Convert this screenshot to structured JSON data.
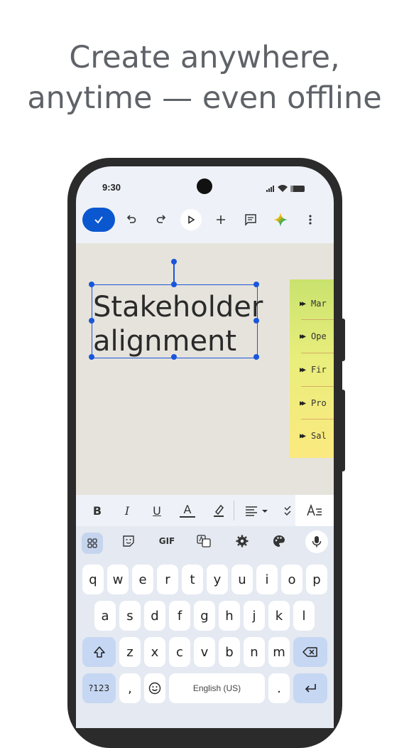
{
  "headline": {
    "line1": "Create anywhere,",
    "line2": "anytime — even offline"
  },
  "status_bar": {
    "time": "9:30"
  },
  "toolbar": {
    "items": [
      "check-icon",
      "undo-icon",
      "redo-icon",
      "present-icon",
      "add-icon",
      "comment-icon",
      "gemini-icon",
      "more-vert-icon"
    ]
  },
  "slide": {
    "title_line1": "Stakeholder",
    "title_line2": "alignment",
    "sticky_items": [
      "Mar",
      "Ope",
      "Fir",
      "Pro",
      "Sal"
    ]
  },
  "format_bar": {
    "bold": "B",
    "italic": "I",
    "underline": "U",
    "text_color": "A"
  },
  "keyboard": {
    "toolbar": {
      "gif": "GIF"
    },
    "row1": [
      "q",
      "w",
      "e",
      "r",
      "t",
      "y",
      "u",
      "i",
      "o",
      "p"
    ],
    "row2": [
      "a",
      "s",
      "d",
      "f",
      "g",
      "h",
      "j",
      "k",
      "l"
    ],
    "row3": [
      "z",
      "x",
      "c",
      "v",
      "b",
      "n",
      "m"
    ],
    "symbols_label": "?123",
    "comma": ",",
    "space_label": "English (US)",
    "period": "."
  },
  "colors": {
    "accent": "#0b57d0",
    "selection": "#1a56db",
    "canvas": "#e6e3dc",
    "headline": "#5f6368"
  }
}
